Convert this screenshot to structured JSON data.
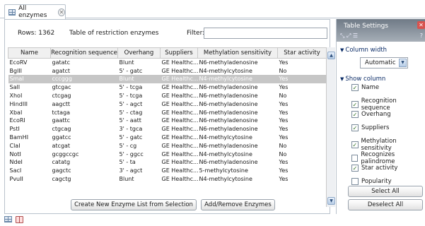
{
  "tab": {
    "label": "All enzymes",
    "icon": "table-icon",
    "close_icon": "close-icon"
  },
  "main": {
    "rows_label": "Rows: 1362",
    "table_title": "Table of restriction enzymes",
    "filter_label": "Filter:",
    "filter_value": "",
    "columns": [
      "Name",
      "Recognition sequence",
      "Overhang",
      "Suppliers",
      "Methylation sensitivity",
      "Star activity"
    ],
    "rows": [
      [
        "EcoRV",
        "gatatc",
        "Blunt",
        "GE Healthc...",
        "N6-methyladenosine",
        "Yes"
      ],
      [
        "BglII",
        "agatct",
        "5' - gatc",
        "GE Healthc...",
        "N4-methylcytosine",
        "No"
      ],
      [
        "SmaI",
        "cccggg",
        "Blunt",
        "GE Healthc...",
        "N4-methylcytosine",
        "Yes"
      ],
      [
        "SalI",
        "gtcgac",
        "5' - tcga",
        "GE Healthc...",
        "N6-methyladenosine",
        "Yes"
      ],
      [
        "XhoI",
        "ctcgag",
        "5' - tcga",
        "GE Healthc...",
        "N6-methyladenosine",
        "No"
      ],
      [
        "HindIII",
        "aagctt",
        "5' - agct",
        "GE Healthc...",
        "N6-methyladenosine",
        "Yes"
      ],
      [
        "XbaI",
        "tctaga",
        "5' - ctag",
        "GE Healthc...",
        "N6-methyladenosine",
        "Yes"
      ],
      [
        "EcoRI",
        "gaattc",
        "5' - aatt",
        "GE Healthc...",
        "N6-methyladenosine",
        "Yes"
      ],
      [
        "PstI",
        "ctgcag",
        "3' - tgca",
        "GE Healthc...",
        "N6-methyladenosine",
        "Yes"
      ],
      [
        "BamHI",
        "ggatcc",
        "5' - gatc",
        "GE Healthc...",
        "N4-methylcytosine",
        "Yes"
      ],
      [
        "ClaI",
        "atcgat",
        "5' - cg",
        "GE Healthc...",
        "N6-methyladenosine",
        "No"
      ],
      [
        "NotI",
        "gcggccgc",
        "5' - ggcc",
        "GE Healthc...",
        "N4-methylcytosine",
        "No"
      ],
      [
        "NdeI",
        "catatg",
        "5' - ta",
        "GE Healthc...",
        "N6-methyladenosine",
        "Yes"
      ],
      [
        "SacI",
        "gagctc",
        "3' - agct",
        "GE Healthc...",
        "5-methylcytosine",
        "Yes"
      ],
      [
        "PvuII",
        "cagctg",
        "Blunt",
        "GE Healthc...",
        "N4-methylcytosine",
        "Yes"
      ]
    ],
    "selected_row": 2,
    "btn_create": "Create New Enzyme List from Selection",
    "btn_add_remove": "Add/Remove Enzymes"
  },
  "settings": {
    "title": "Table Settings",
    "tools": "⤡ ⤢ ☰",
    "help": "?",
    "column_width_label": "Column width",
    "column_width_value": "Automatic",
    "show_column_label": "Show column",
    "checkboxes": [
      {
        "label": "Name",
        "checked": true
      },
      {
        "label": "Recognition sequence",
        "checked": true
      },
      {
        "label": "Overhang",
        "checked": true
      },
      {
        "label": "Suppliers",
        "checked": true
      },
      {
        "label": "Methylation sensitivity",
        "checked": true
      },
      {
        "label": "Recognizes palindrome",
        "checked": false
      },
      {
        "label": "Star activity",
        "checked": true
      },
      {
        "label": "Popularity",
        "checked": false
      }
    ],
    "btn_select_all": "Select All",
    "btn_deselect_all": "Deselect All"
  },
  "colors": {
    "header_gradient_top": "#6f7a86",
    "selected_row": "#c6c6c6",
    "section_label": "#0a2b66"
  }
}
